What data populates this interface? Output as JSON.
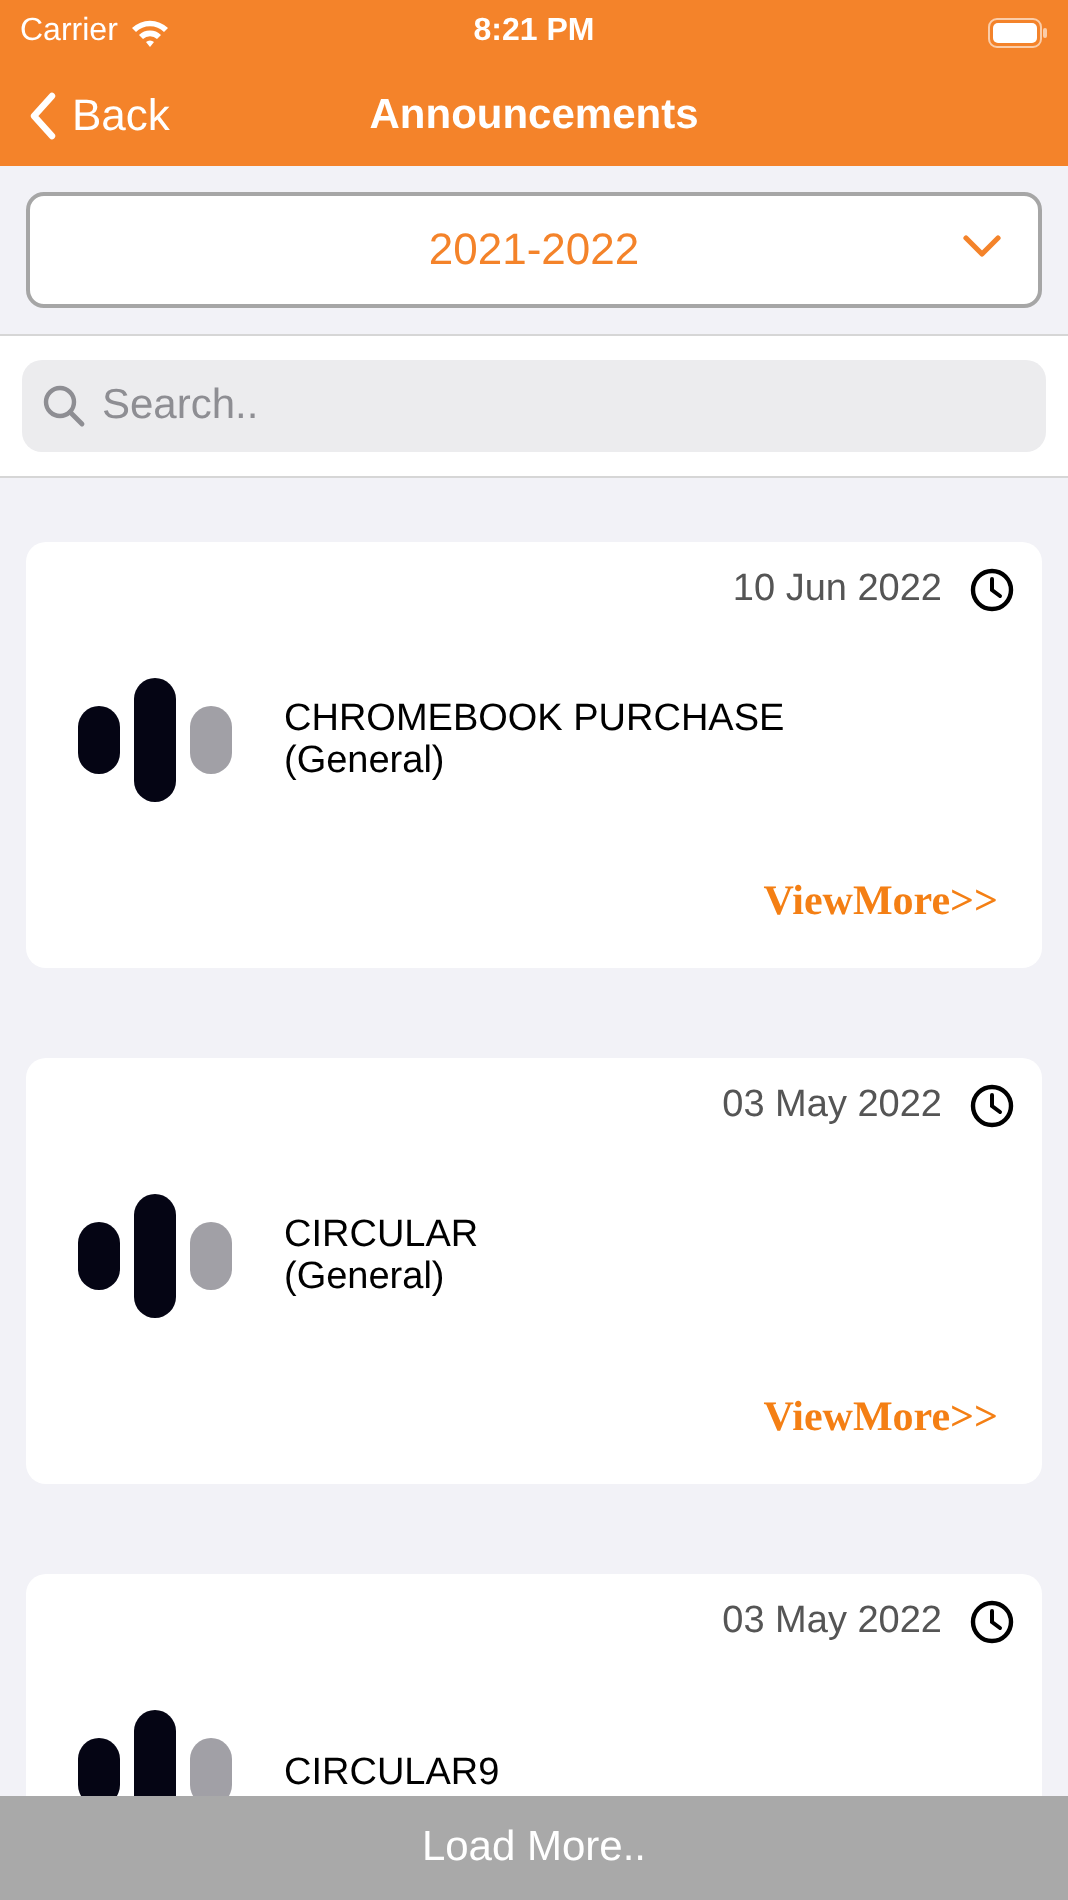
{
  "status_bar": {
    "carrier": "Carrier",
    "time": "8:21 PM"
  },
  "nav": {
    "back": "Back",
    "title": "Announcements"
  },
  "year_picker": {
    "value": "2021-2022"
  },
  "search": {
    "placeholder": "Search.."
  },
  "announcements": [
    {
      "date": "10 Jun 2022",
      "title": "CHROMEBOOK PURCHASE",
      "category": "(General)",
      "link": "ViewMore>>"
    },
    {
      "date": "03 May 2022",
      "title": "CIRCULAR",
      "category": "(General)",
      "link": "ViewMore>>"
    },
    {
      "date": "03 May 2022",
      "title": "CIRCULAR9"
    }
  ],
  "load_more": "Load More.."
}
